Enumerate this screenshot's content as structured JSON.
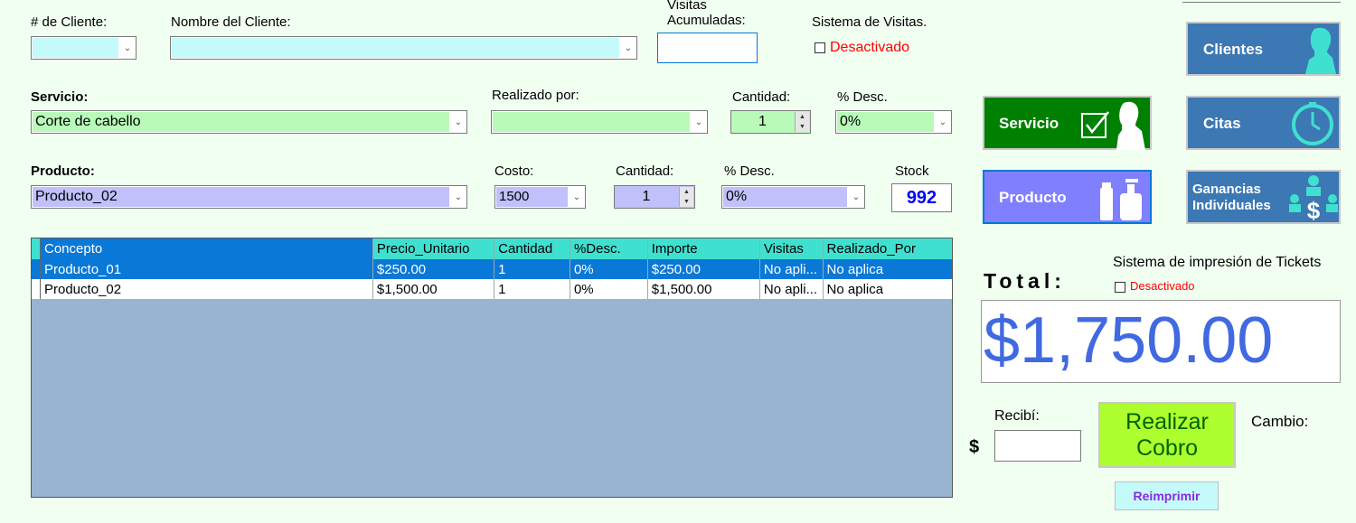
{
  "cliente": {
    "num_label": "# de Cliente:",
    "nombre_label": "Nombre del Cliente:",
    "visitas_label_1": "Visitas",
    "visitas_label_2": "Acumuladas:",
    "sistema_visitas_label": "Sistema de Visitas.",
    "sistema_visitas_state": "Desactivado",
    "num_value": "",
    "nombre_value": "",
    "visitas_value": ""
  },
  "servicio": {
    "label": "Servicio:",
    "value": "Corte de cabello",
    "realizado_label": "Realizado por:",
    "realizado_value": "",
    "cantidad_label": "Cantidad:",
    "cantidad_value": "1",
    "desc_label": "% Desc.",
    "desc_value": "0%"
  },
  "producto": {
    "label": "Producto:",
    "value": "Producto_02",
    "costo_label": "Costo:",
    "costo_value": "1500",
    "cantidad_label": "Cantidad:",
    "cantidad_value": "1",
    "desc_label": "% Desc.",
    "desc_value": "0%",
    "stock_label": "Stock",
    "stock_value": "992"
  },
  "table": {
    "columns": [
      "Concepto",
      "Precio_Unitario",
      "Cantidad",
      "%Desc.",
      "Importe",
      "Visitas",
      "Realizado_Por"
    ],
    "rows": [
      [
        "Producto_01",
        "$250.00",
        "1",
        "0%",
        "$250.00",
        "No apli...",
        "No aplica"
      ],
      [
        "Producto_02",
        "$1,500.00",
        "1",
        "0%",
        "$1,500.00",
        "No apli...",
        "No aplica"
      ]
    ],
    "selected_row": 0
  },
  "buttons": {
    "servicio": "Servicio",
    "producto": "Producto",
    "clientes": "Clientes",
    "citas": "Citas",
    "ganancias_1": "Ganancias",
    "ganancias_2": "Individuales",
    "cobro_1": "Realizar",
    "cobro_2": "Cobro",
    "reimprimir": "Reimprimir"
  },
  "totals": {
    "total_label": "Total:",
    "tickets_label": "Sistema de impresión de Tickets",
    "tickets_state": "Desactivado",
    "total_value": "$1,750.00",
    "recibi_label": "Recibí:",
    "currency_symbol": "$",
    "recibi_value": "",
    "cambio_label": "Cambio:"
  },
  "colors": {
    "background": "#f0fff0",
    "service_green": "#b9fab9",
    "product_purple": "#c0c0fa",
    "cyan_input": "#c4fafa",
    "blue_button": "#3c78b4",
    "green_button": "#008000",
    "purple_button": "#8080ff",
    "cobro_button": "#adff2f",
    "reimprimir_button": "#c4fafa",
    "total_text": "#4169e1",
    "desactivado_red": "#ff0000",
    "grid_body": "#99b4d1",
    "stock_blue": "#0000ff"
  }
}
